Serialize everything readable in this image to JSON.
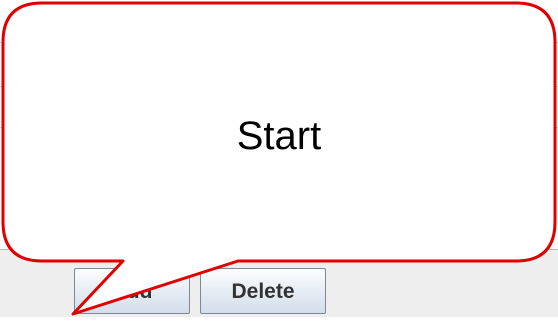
{
  "buttons": {
    "add_label": "Add",
    "delete_label": "Delete"
  },
  "callout": {
    "text": "Start",
    "border_color": "#e00000",
    "fill_color": "#ffffff"
  }
}
